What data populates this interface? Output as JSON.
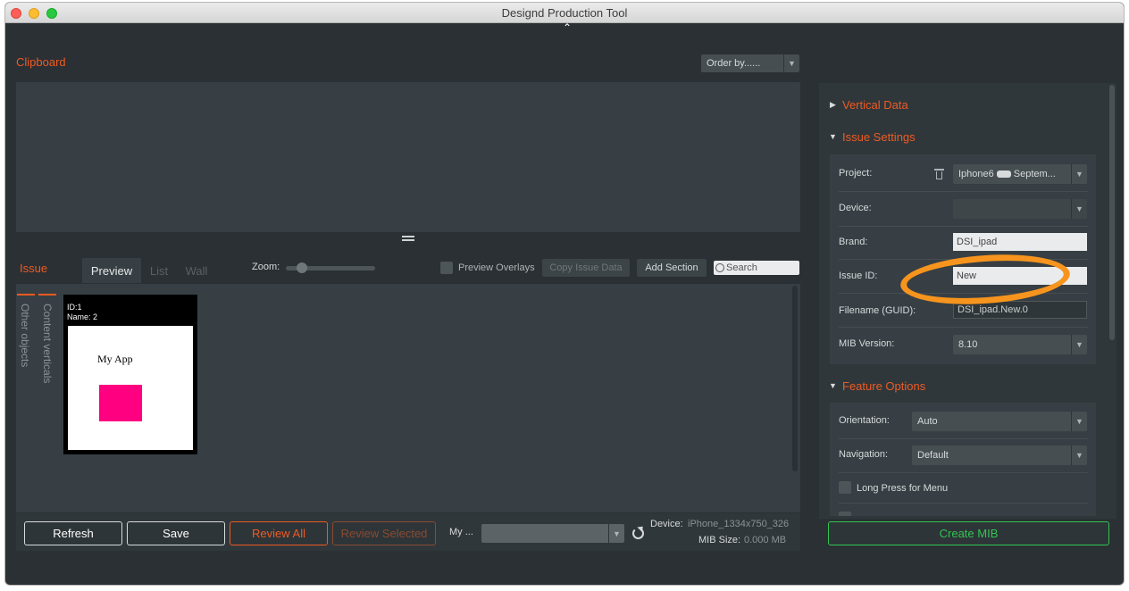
{
  "window": {
    "title": "Designd Production Tool"
  },
  "clipboard": {
    "title": "Clipboard",
    "order_by": "Order by......"
  },
  "issue": {
    "title": "Issue",
    "tabs": [
      "Preview",
      "List",
      "Wall"
    ],
    "zoom_label": "Zoom:",
    "preview_overlays": "Preview Overlays",
    "copy_issue_data": "Copy Issue Data",
    "add_section": "Add Section",
    "search_placeholder": "Search",
    "vertical_tabs": [
      "Other objects",
      "Content verticals"
    ],
    "thumbnail": {
      "id": "ID:1",
      "name": "Name: 2",
      "app_name": "My App",
      "accent": "#ff0080"
    }
  },
  "bottom_bar": {
    "refresh": "Refresh",
    "save": "Save",
    "review_all": "Review All",
    "review_selected": "Review Selected",
    "my_label": "My ...",
    "device_label": "Device:",
    "device_value": "iPhone_1334x750_326",
    "mib_size_label": "MIB Size:",
    "mib_size_value": "0.000 MB"
  },
  "right_panel": {
    "vertical_data": "Vertical Data",
    "issue_settings": {
      "title": "Issue Settings",
      "project_label": "Project:",
      "project_value_a": "Iphone6",
      "project_value_b": "Septem...",
      "device_label": "Device:",
      "brand_label": "Brand:",
      "brand_value": "DSI_ipad",
      "issue_id_label": "Issue ID:",
      "issue_id_value": "New",
      "filename_label": "Filename (GUID):",
      "filename_value": "DSI_ipad.New.0",
      "mib_version_label": "MIB Version:",
      "mib_version_value": "8.10"
    },
    "feature_options": {
      "title": "Feature Options",
      "orientation_label": "Orientation:",
      "orientation_value": "Auto",
      "navigation_label": "Navigation:",
      "navigation_value": "Default",
      "long_press_label": "Long Press for Menu"
    },
    "create_mib": "Create MIB"
  },
  "colors": {
    "accent": "#ee5a24",
    "create": "#31c452",
    "highlight": "#f7941d"
  }
}
